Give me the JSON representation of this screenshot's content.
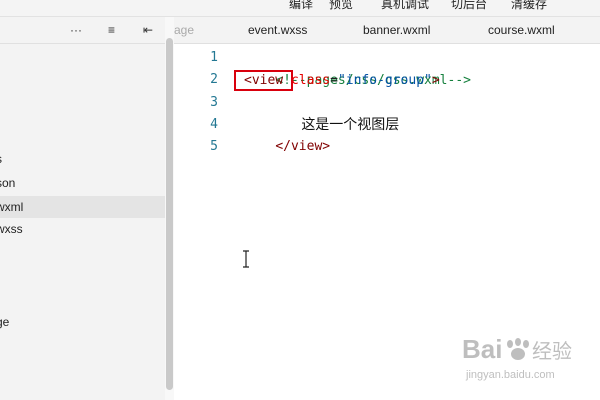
{
  "toolbar": {
    "items": [
      "编译",
      "预览",
      "真机调试",
      "切后台",
      "清缓存"
    ]
  },
  "sidebar": {
    "header_icons": [
      "more-icon",
      "collapse-icon",
      "split-icon"
    ],
    "header_glyphs": [
      "···",
      "≡",
      "⇤"
    ],
    "items": [
      {
        "label": "s",
        "active": false
      },
      {
        "label": "son",
        "active": false
      },
      {
        "label": "wxml",
        "active": true
      },
      {
        "label": "wxss",
        "active": false
      },
      {
        "label": "ge",
        "active": false
      }
    ]
  },
  "tabs": [
    {
      "label": "age",
      "faded": true
    },
    {
      "label": "event.wxss",
      "faded": false
    },
    {
      "label": "banner.wxml",
      "faded": false
    },
    {
      "label": "course.wxml",
      "faded": false
    }
  ],
  "editor": {
    "line_numbers": [
      "1",
      "2",
      "3",
      "4",
      "5"
    ],
    "line1": {
      "comment": "<!--pages/css/css.wxml-->"
    },
    "line2": {
      "open_tag": "<view",
      "attr": "class",
      "eq": "=",
      "value": "\"info-group\"",
      "close": ">"
    },
    "line3": {
      "text": "这是一个视图层"
    },
    "line4": {
      "close_tag": "</view>"
    }
  },
  "watermark": {
    "brand": "Bai",
    "brand2": "du",
    "cn": "经验",
    "url": "jingyan.baidu.com"
  },
  "colors": {
    "highlight": "#d9000d",
    "line_number": "#237893",
    "comment": "#15803d",
    "tag": "#800000",
    "attribute": "#e50000",
    "string": "#0451a5"
  }
}
